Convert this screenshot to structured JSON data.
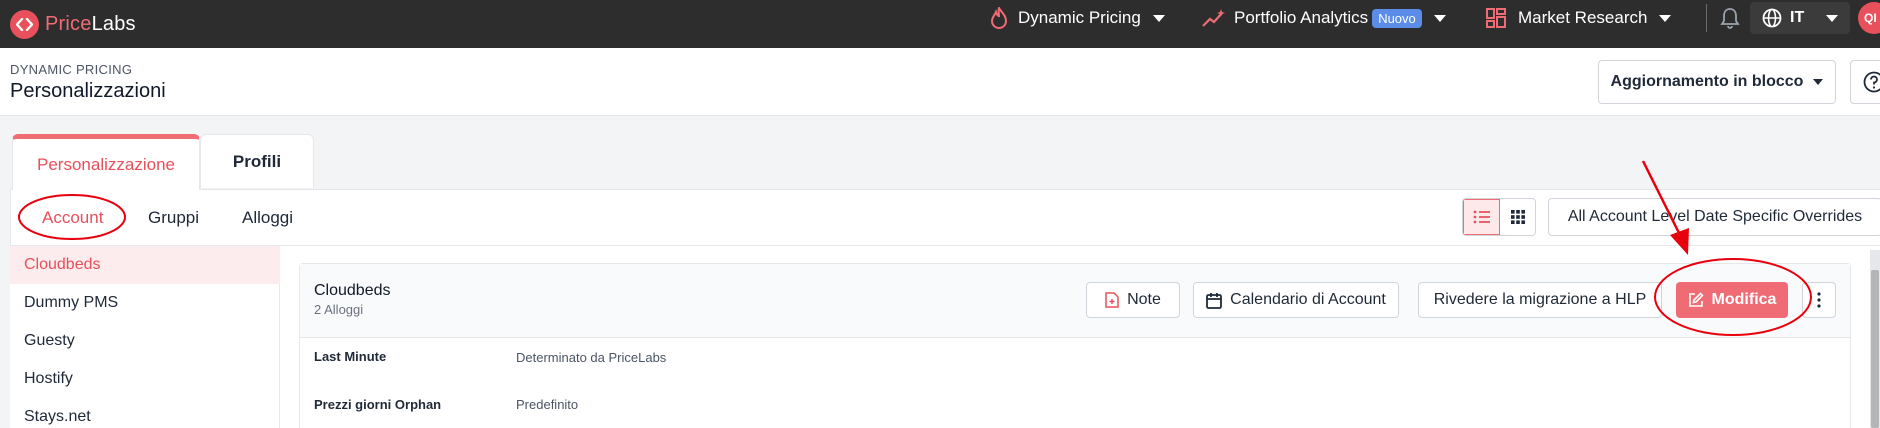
{
  "navbar": {
    "brand_primary": "Price",
    "brand_secondary": "Labs",
    "items": [
      {
        "label": "Dynamic Pricing"
      },
      {
        "label": "Portfolio Analytics",
        "badge": "Nuovo"
      },
      {
        "label": "Market Research"
      }
    ],
    "language": "IT",
    "avatar_initials": "QI"
  },
  "header": {
    "breadcrumb": "DYNAMIC PRICING",
    "title": "Personalizzazioni",
    "bulk_update_label": "Aggiornamento in blocco"
  },
  "tabs": {
    "main": [
      "Personalizzazione",
      "Profili"
    ],
    "sub": [
      "Account",
      "Gruppi",
      "Alloggi"
    ],
    "override_button": "All Account Level Date Specific Overrides"
  },
  "sidebar": {
    "items": [
      "Cloudbeds",
      "Dummy PMS",
      "Guesty",
      "Hostify",
      "Stays.net"
    ]
  },
  "account": {
    "name": "Cloudbeds",
    "subtitle": "2 Alloggi",
    "buttons": {
      "note": "Note",
      "calendar": "Calendario di Account",
      "migration": "Rivedere la migrazione a HLP",
      "edit": "Modifica"
    },
    "rows": [
      {
        "label": "Last Minute",
        "value": "Determinato da PriceLabs"
      },
      {
        "label": "Prezzi giorni Orphan",
        "value": "Predefinito"
      }
    ]
  },
  "colors": {
    "brand": "#e8505b",
    "topbar": "#2d2d2d",
    "annotation": "#e8000d",
    "badge": "#5b8de8"
  }
}
